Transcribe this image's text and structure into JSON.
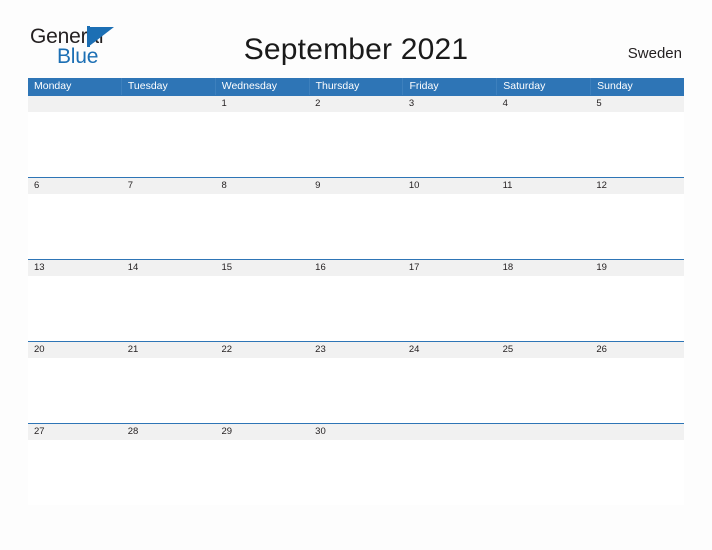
{
  "brand": {
    "name_part1": "General",
    "name_part2": "Blue",
    "triangle_color": "#1c6fb4"
  },
  "header": {
    "title": "September 2021",
    "region": "Sweden"
  },
  "colors": {
    "header_blue": "#2e75b6",
    "date_band_gray": "#f1f1f1",
    "text_dark": "#231f20",
    "brand_blue": "#1c6fb4"
  },
  "calendar": {
    "month": "September",
    "year": "2021",
    "weekday_headers": [
      "Monday",
      "Tuesday",
      "Wednesday",
      "Thursday",
      "Friday",
      "Saturday",
      "Sunday"
    ],
    "weeks": [
      [
        "",
        "",
        "1",
        "2",
        "3",
        "4",
        "5"
      ],
      [
        "6",
        "7",
        "8",
        "9",
        "10",
        "11",
        "12"
      ],
      [
        "13",
        "14",
        "15",
        "16",
        "17",
        "18",
        "19"
      ],
      [
        "20",
        "21",
        "22",
        "23",
        "24",
        "25",
        "26"
      ],
      [
        "27",
        "28",
        "29",
        "30",
        "",
        "",
        ""
      ]
    ]
  }
}
